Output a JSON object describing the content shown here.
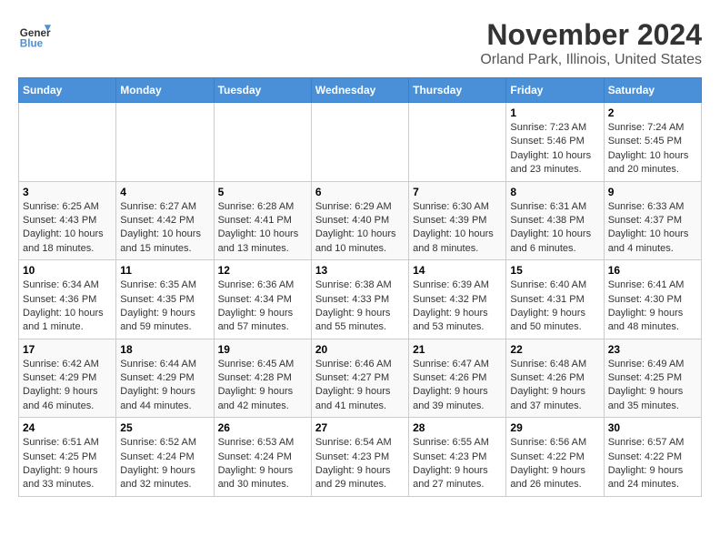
{
  "header": {
    "logo_general": "General",
    "logo_blue": "Blue",
    "title": "November 2024",
    "subtitle": "Orland Park, Illinois, United States"
  },
  "weekdays": [
    "Sunday",
    "Monday",
    "Tuesday",
    "Wednesday",
    "Thursday",
    "Friday",
    "Saturday"
  ],
  "weeks": [
    [
      {
        "day": "",
        "info": ""
      },
      {
        "day": "",
        "info": ""
      },
      {
        "day": "",
        "info": ""
      },
      {
        "day": "",
        "info": ""
      },
      {
        "day": "",
        "info": ""
      },
      {
        "day": "1",
        "info": "Sunrise: 7:23 AM\nSunset: 5:46 PM\nDaylight: 10 hours and 23 minutes."
      },
      {
        "day": "2",
        "info": "Sunrise: 7:24 AM\nSunset: 5:45 PM\nDaylight: 10 hours and 20 minutes."
      }
    ],
    [
      {
        "day": "3",
        "info": "Sunrise: 6:25 AM\nSunset: 4:43 PM\nDaylight: 10 hours and 18 minutes."
      },
      {
        "day": "4",
        "info": "Sunrise: 6:27 AM\nSunset: 4:42 PM\nDaylight: 10 hours and 15 minutes."
      },
      {
        "day": "5",
        "info": "Sunrise: 6:28 AM\nSunset: 4:41 PM\nDaylight: 10 hours and 13 minutes."
      },
      {
        "day": "6",
        "info": "Sunrise: 6:29 AM\nSunset: 4:40 PM\nDaylight: 10 hours and 10 minutes."
      },
      {
        "day": "7",
        "info": "Sunrise: 6:30 AM\nSunset: 4:39 PM\nDaylight: 10 hours and 8 minutes."
      },
      {
        "day": "8",
        "info": "Sunrise: 6:31 AM\nSunset: 4:38 PM\nDaylight: 10 hours and 6 minutes."
      },
      {
        "day": "9",
        "info": "Sunrise: 6:33 AM\nSunset: 4:37 PM\nDaylight: 10 hours and 4 minutes."
      }
    ],
    [
      {
        "day": "10",
        "info": "Sunrise: 6:34 AM\nSunset: 4:36 PM\nDaylight: 10 hours and 1 minute."
      },
      {
        "day": "11",
        "info": "Sunrise: 6:35 AM\nSunset: 4:35 PM\nDaylight: 9 hours and 59 minutes."
      },
      {
        "day": "12",
        "info": "Sunrise: 6:36 AM\nSunset: 4:34 PM\nDaylight: 9 hours and 57 minutes."
      },
      {
        "day": "13",
        "info": "Sunrise: 6:38 AM\nSunset: 4:33 PM\nDaylight: 9 hours and 55 minutes."
      },
      {
        "day": "14",
        "info": "Sunrise: 6:39 AM\nSunset: 4:32 PM\nDaylight: 9 hours and 53 minutes."
      },
      {
        "day": "15",
        "info": "Sunrise: 6:40 AM\nSunset: 4:31 PM\nDaylight: 9 hours and 50 minutes."
      },
      {
        "day": "16",
        "info": "Sunrise: 6:41 AM\nSunset: 4:30 PM\nDaylight: 9 hours and 48 minutes."
      }
    ],
    [
      {
        "day": "17",
        "info": "Sunrise: 6:42 AM\nSunset: 4:29 PM\nDaylight: 9 hours and 46 minutes."
      },
      {
        "day": "18",
        "info": "Sunrise: 6:44 AM\nSunset: 4:29 PM\nDaylight: 9 hours and 44 minutes."
      },
      {
        "day": "19",
        "info": "Sunrise: 6:45 AM\nSunset: 4:28 PM\nDaylight: 9 hours and 42 minutes."
      },
      {
        "day": "20",
        "info": "Sunrise: 6:46 AM\nSunset: 4:27 PM\nDaylight: 9 hours and 41 minutes."
      },
      {
        "day": "21",
        "info": "Sunrise: 6:47 AM\nSunset: 4:26 PM\nDaylight: 9 hours and 39 minutes."
      },
      {
        "day": "22",
        "info": "Sunrise: 6:48 AM\nSunset: 4:26 PM\nDaylight: 9 hours and 37 minutes."
      },
      {
        "day": "23",
        "info": "Sunrise: 6:49 AM\nSunset: 4:25 PM\nDaylight: 9 hours and 35 minutes."
      }
    ],
    [
      {
        "day": "24",
        "info": "Sunrise: 6:51 AM\nSunset: 4:25 PM\nDaylight: 9 hours and 33 minutes."
      },
      {
        "day": "25",
        "info": "Sunrise: 6:52 AM\nSunset: 4:24 PM\nDaylight: 9 hours and 32 minutes."
      },
      {
        "day": "26",
        "info": "Sunrise: 6:53 AM\nSunset: 4:24 PM\nDaylight: 9 hours and 30 minutes."
      },
      {
        "day": "27",
        "info": "Sunrise: 6:54 AM\nSunset: 4:23 PM\nDaylight: 9 hours and 29 minutes."
      },
      {
        "day": "28",
        "info": "Sunrise: 6:55 AM\nSunset: 4:23 PM\nDaylight: 9 hours and 27 minutes."
      },
      {
        "day": "29",
        "info": "Sunrise: 6:56 AM\nSunset: 4:22 PM\nDaylight: 9 hours and 26 minutes."
      },
      {
        "day": "30",
        "info": "Sunrise: 6:57 AM\nSunset: 4:22 PM\nDaylight: 9 hours and 24 minutes."
      }
    ]
  ]
}
